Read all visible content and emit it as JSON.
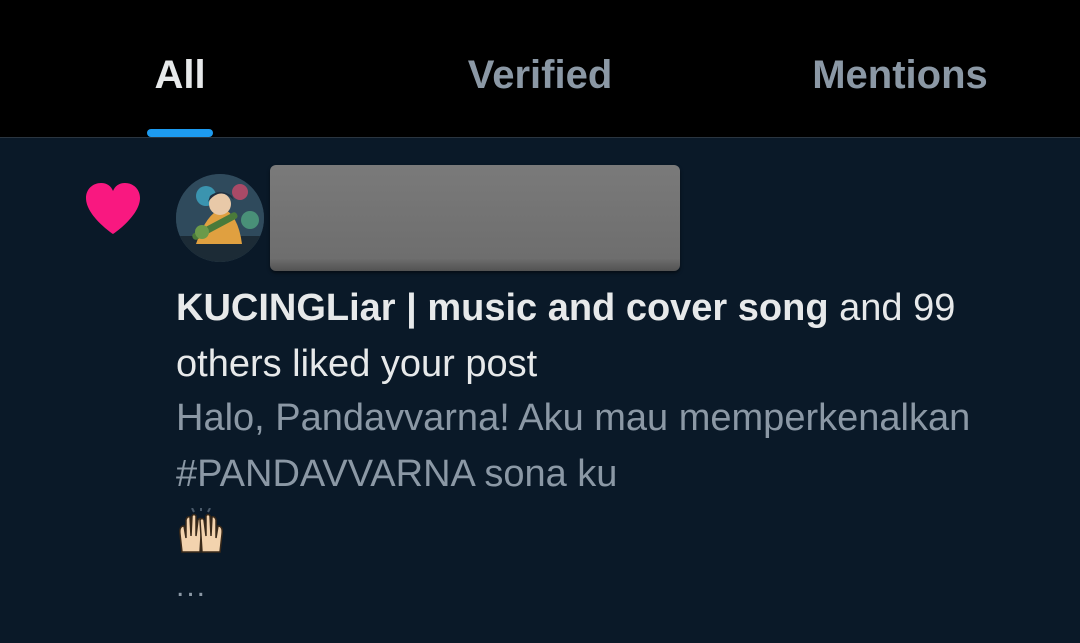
{
  "tabs": [
    {
      "label": "All",
      "active": true
    },
    {
      "label": "Verified",
      "active": false
    },
    {
      "label": "Mentions",
      "active": false
    }
  ],
  "notification": {
    "type_icon": "heart-icon",
    "actor_name": "KUCINGLiar | music and cover song",
    "action_text": " and 99 others liked your post",
    "post_preview": "Halo, Pandavvarna! Aku mau memperkenalkan #PANDAVVARNA sona ku",
    "post_emoji": "raising-hands-icon",
    "truncation": "..."
  },
  "colors": {
    "accent": "#1d9bf0",
    "heart": "#f91880",
    "background": "#0a1928",
    "tab_bar": "#000000"
  }
}
